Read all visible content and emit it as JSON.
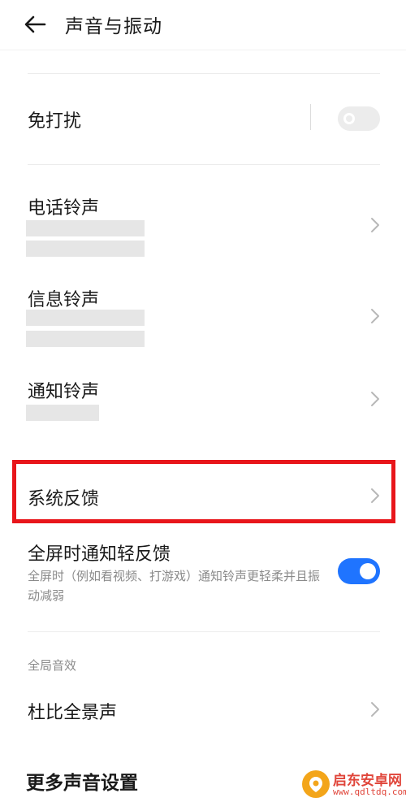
{
  "header": {
    "title": "声音与振动"
  },
  "dnd": {
    "label": "免打扰",
    "toggle_on": false
  },
  "ringtones": [
    {
      "label": "电话铃声"
    },
    {
      "label": "信息铃声"
    },
    {
      "label": "通知铃声"
    }
  ],
  "system_feedback": {
    "label": "系统反馈"
  },
  "fullscreen_feedback": {
    "label": "全屏时通知轻反馈",
    "description": "全屏时（例如看视频、打游戏）通知铃声更轻柔并且振动减弱",
    "toggle_on": true
  },
  "section": {
    "label": "全局音效"
  },
  "dolby": {
    "label": "杜比全景声"
  },
  "more": {
    "label": "更多声音设置"
  },
  "watermark": {
    "name": "启东安卓网",
    "url": "www.qdltdq.com"
  },
  "colors": {
    "accent": "#1f74ff",
    "highlight": "#e8161b",
    "watermark": "#e0453a"
  }
}
